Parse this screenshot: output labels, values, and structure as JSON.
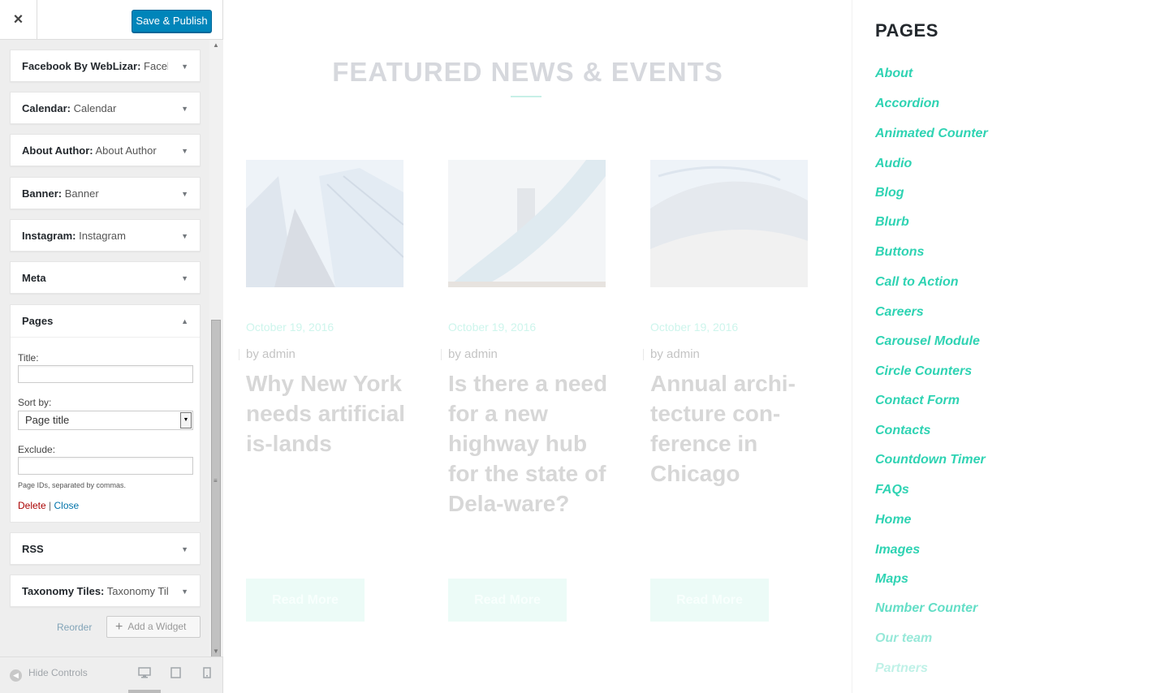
{
  "panel": {
    "close_icon": "×",
    "save_label": "Save & Publish",
    "widgets": [
      {
        "name": "Facebook By WebLizar:",
        "title": "Faceb..."
      },
      {
        "name": "Calendar:",
        "title": "Calendar"
      },
      {
        "name": "About Author:",
        "title": "About Author"
      },
      {
        "name": "Banner:",
        "title": "Banner"
      },
      {
        "name": "Instagram:",
        "title": "Instagram"
      },
      {
        "name": "Meta",
        "title": ""
      }
    ],
    "pages_widget": {
      "name": "Pages",
      "title_label": "Title:",
      "title_value": "",
      "sortby_label": "Sort by:",
      "sortby_value": "Page title",
      "exclude_label": "Exclude:",
      "exclude_value": "",
      "hint": "Page IDs, separated by commas.",
      "delete_label": "Delete",
      "separator": "|",
      "close_label": "Close"
    },
    "widgets_after": [
      {
        "name": "RSS",
        "title": ""
      },
      {
        "name": "Taxonomy Tiles:",
        "title": "Taxonomy Til..."
      }
    ],
    "reorder_label": "Reorder",
    "add_widget_label": "Add a Widget",
    "hide_controls_label": "Hide Controls"
  },
  "preview": {
    "section_title": "FEATURED NEWS & EVENTS",
    "posts": [
      {
        "date": "October 19, 2016",
        "by": "by admin",
        "title": "Why New York needs artificial is-lands",
        "read_more": "Read More"
      },
      {
        "date": "October 19, 2016",
        "by": "by admin",
        "title": "Is there a need for a new highway hub for the state of Dela-ware?",
        "read_more": "Read More"
      },
      {
        "date": "October 19, 2016",
        "by": "by admin",
        "title": "Annual archi-tecture con-ference in Chicago",
        "read_more": "Read More"
      }
    ],
    "sidebar": {
      "title": "PAGES",
      "pages": [
        "About",
        "Accordion",
        "Animated Counter",
        "Audio",
        "Blog",
        "Blurb",
        "Buttons",
        "Call to Action",
        "Careers",
        "Carousel Module",
        "Circle Counters",
        "Contact Form",
        "Contacts",
        "Countdown Timer",
        "FAQs",
        "Home",
        "Images",
        "Maps",
        "Number Counter",
        "Our team",
        "Partners"
      ]
    }
  },
  "colors": {
    "accent": "#2fd3b3",
    "primary_button": "#0085ba",
    "delete": "#a00000",
    "link": "#0073aa"
  }
}
